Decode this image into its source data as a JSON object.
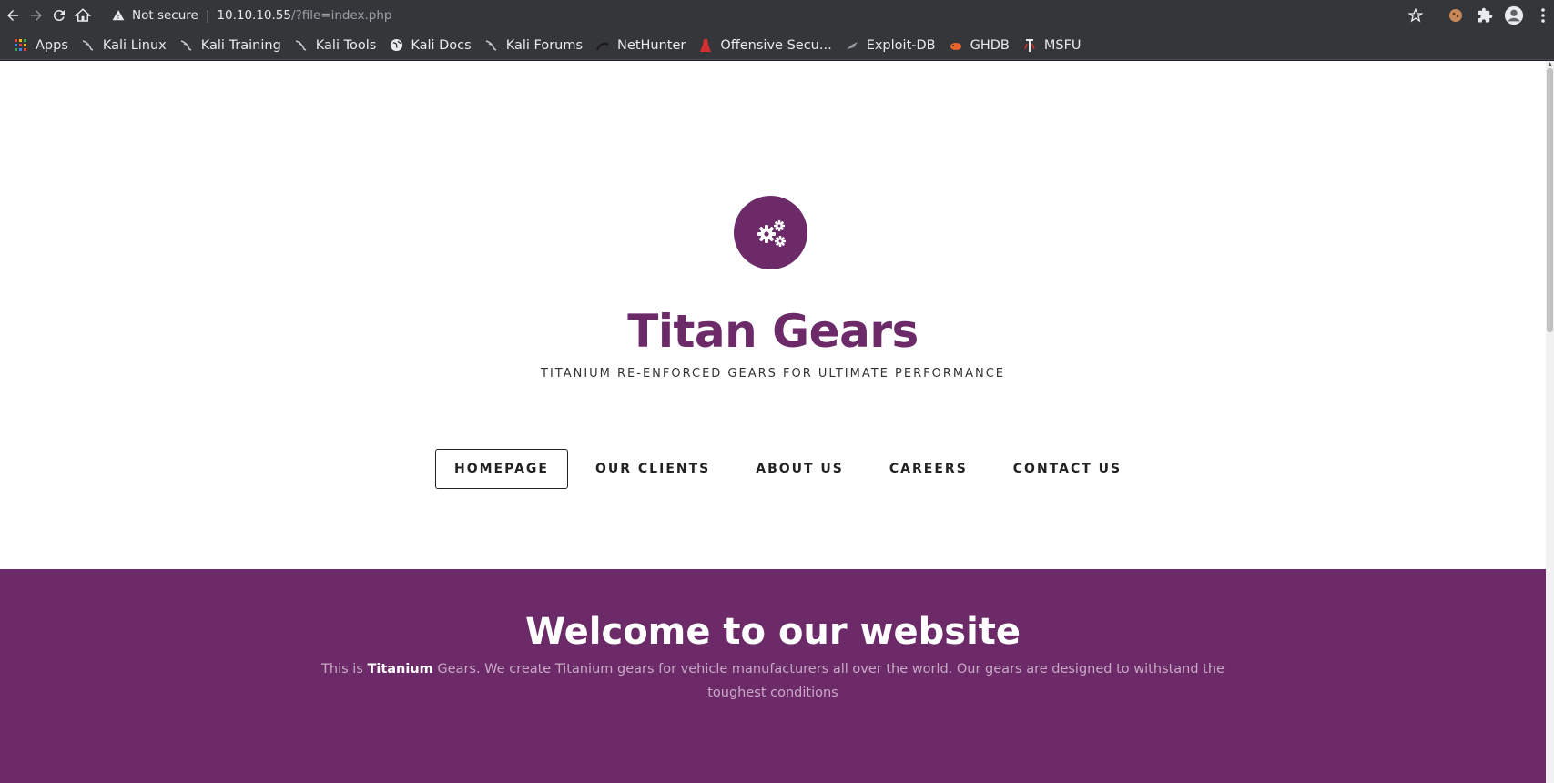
{
  "browser": {
    "security_label": "Not secure",
    "url_host": "10.10.10.55",
    "url_path": "/?file=index.php"
  },
  "bookmarks": [
    {
      "label": "Apps",
      "icon": "apps-grid-icon"
    },
    {
      "label": "Kali Linux",
      "icon": "kali-dragon-icon"
    },
    {
      "label": "Kali Training",
      "icon": "kali-dragon-icon"
    },
    {
      "label": "Kali Tools",
      "icon": "kali-dragon-icon"
    },
    {
      "label": "Kali Docs",
      "icon": "globe-icon"
    },
    {
      "label": "Kali Forums",
      "icon": "kali-dragon-icon"
    },
    {
      "label": "NetHunter",
      "icon": "nethunter-icon"
    },
    {
      "label": "Offensive Secu...",
      "icon": "offsec-icon"
    },
    {
      "label": "Exploit-DB",
      "icon": "exploitdb-icon"
    },
    {
      "label": "GHDB",
      "icon": "ghdb-icon"
    },
    {
      "label": "MSFU",
      "icon": "msfu-icon"
    }
  ],
  "site": {
    "title": "Titan Gears",
    "tagline": "TITANIUM RE-ENFORCED GEARS FOR ULTIMATE PERFORMANCE",
    "logo_icon": "gears-icon",
    "brand_color": "#6c2a68"
  },
  "menu": [
    {
      "label": "HOMEPAGE",
      "active": true
    },
    {
      "label": "OUR CLIENTS",
      "active": false
    },
    {
      "label": "ABOUT US",
      "active": false
    },
    {
      "label": "CAREERS",
      "active": false
    },
    {
      "label": "CONTACT US",
      "active": false
    }
  ],
  "welcome": {
    "title": "Welcome to our website",
    "text_before": "This is ",
    "text_bold": "Titanium",
    "text_after": " Gears. We create Titanium gears for vehicle manufacturers all over the world. Our gears are designed to withstand the toughest conditions"
  }
}
